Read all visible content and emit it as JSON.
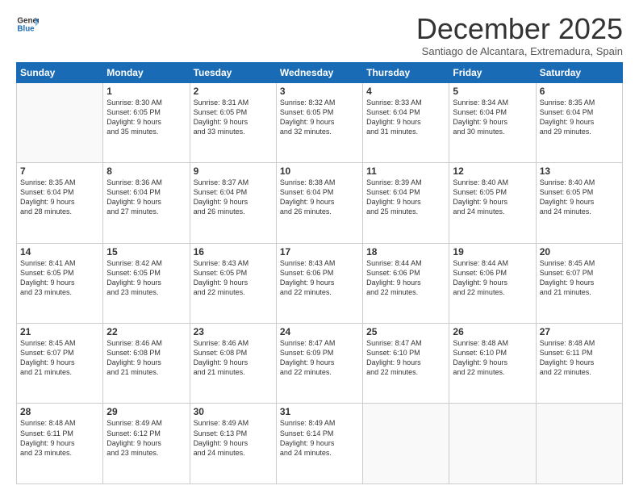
{
  "header": {
    "logo_general": "General",
    "logo_blue": "Blue",
    "month_title": "December 2025",
    "location": "Santiago de Alcantara, Extremadura, Spain"
  },
  "days_of_week": [
    "Sunday",
    "Monday",
    "Tuesday",
    "Wednesday",
    "Thursday",
    "Friday",
    "Saturday"
  ],
  "weeks": [
    [
      {
        "day": "",
        "info": ""
      },
      {
        "day": "1",
        "info": "Sunrise: 8:30 AM\nSunset: 6:05 PM\nDaylight: 9 hours\nand 35 minutes."
      },
      {
        "day": "2",
        "info": "Sunrise: 8:31 AM\nSunset: 6:05 PM\nDaylight: 9 hours\nand 33 minutes."
      },
      {
        "day": "3",
        "info": "Sunrise: 8:32 AM\nSunset: 6:05 PM\nDaylight: 9 hours\nand 32 minutes."
      },
      {
        "day": "4",
        "info": "Sunrise: 8:33 AM\nSunset: 6:04 PM\nDaylight: 9 hours\nand 31 minutes."
      },
      {
        "day": "5",
        "info": "Sunrise: 8:34 AM\nSunset: 6:04 PM\nDaylight: 9 hours\nand 30 minutes."
      },
      {
        "day": "6",
        "info": "Sunrise: 8:35 AM\nSunset: 6:04 PM\nDaylight: 9 hours\nand 29 minutes."
      }
    ],
    [
      {
        "day": "7",
        "info": "Sunrise: 8:35 AM\nSunset: 6:04 PM\nDaylight: 9 hours\nand 28 minutes."
      },
      {
        "day": "8",
        "info": "Sunrise: 8:36 AM\nSunset: 6:04 PM\nDaylight: 9 hours\nand 27 minutes."
      },
      {
        "day": "9",
        "info": "Sunrise: 8:37 AM\nSunset: 6:04 PM\nDaylight: 9 hours\nand 26 minutes."
      },
      {
        "day": "10",
        "info": "Sunrise: 8:38 AM\nSunset: 6:04 PM\nDaylight: 9 hours\nand 26 minutes."
      },
      {
        "day": "11",
        "info": "Sunrise: 8:39 AM\nSunset: 6:04 PM\nDaylight: 9 hours\nand 25 minutes."
      },
      {
        "day": "12",
        "info": "Sunrise: 8:40 AM\nSunset: 6:05 PM\nDaylight: 9 hours\nand 24 minutes."
      },
      {
        "day": "13",
        "info": "Sunrise: 8:40 AM\nSunset: 6:05 PM\nDaylight: 9 hours\nand 24 minutes."
      }
    ],
    [
      {
        "day": "14",
        "info": "Sunrise: 8:41 AM\nSunset: 6:05 PM\nDaylight: 9 hours\nand 23 minutes."
      },
      {
        "day": "15",
        "info": "Sunrise: 8:42 AM\nSunset: 6:05 PM\nDaylight: 9 hours\nand 23 minutes."
      },
      {
        "day": "16",
        "info": "Sunrise: 8:43 AM\nSunset: 6:05 PM\nDaylight: 9 hours\nand 22 minutes."
      },
      {
        "day": "17",
        "info": "Sunrise: 8:43 AM\nSunset: 6:06 PM\nDaylight: 9 hours\nand 22 minutes."
      },
      {
        "day": "18",
        "info": "Sunrise: 8:44 AM\nSunset: 6:06 PM\nDaylight: 9 hours\nand 22 minutes."
      },
      {
        "day": "19",
        "info": "Sunrise: 8:44 AM\nSunset: 6:06 PM\nDaylight: 9 hours\nand 22 minutes."
      },
      {
        "day": "20",
        "info": "Sunrise: 8:45 AM\nSunset: 6:07 PM\nDaylight: 9 hours\nand 21 minutes."
      }
    ],
    [
      {
        "day": "21",
        "info": "Sunrise: 8:45 AM\nSunset: 6:07 PM\nDaylight: 9 hours\nand 21 minutes."
      },
      {
        "day": "22",
        "info": "Sunrise: 8:46 AM\nSunset: 6:08 PM\nDaylight: 9 hours\nand 21 minutes."
      },
      {
        "day": "23",
        "info": "Sunrise: 8:46 AM\nSunset: 6:08 PM\nDaylight: 9 hours\nand 21 minutes."
      },
      {
        "day": "24",
        "info": "Sunrise: 8:47 AM\nSunset: 6:09 PM\nDaylight: 9 hours\nand 22 minutes."
      },
      {
        "day": "25",
        "info": "Sunrise: 8:47 AM\nSunset: 6:10 PM\nDaylight: 9 hours\nand 22 minutes."
      },
      {
        "day": "26",
        "info": "Sunrise: 8:48 AM\nSunset: 6:10 PM\nDaylight: 9 hours\nand 22 minutes."
      },
      {
        "day": "27",
        "info": "Sunrise: 8:48 AM\nSunset: 6:11 PM\nDaylight: 9 hours\nand 22 minutes."
      }
    ],
    [
      {
        "day": "28",
        "info": "Sunrise: 8:48 AM\nSunset: 6:11 PM\nDaylight: 9 hours\nand 23 minutes."
      },
      {
        "day": "29",
        "info": "Sunrise: 8:49 AM\nSunset: 6:12 PM\nDaylight: 9 hours\nand 23 minutes."
      },
      {
        "day": "30",
        "info": "Sunrise: 8:49 AM\nSunset: 6:13 PM\nDaylight: 9 hours\nand 24 minutes."
      },
      {
        "day": "31",
        "info": "Sunrise: 8:49 AM\nSunset: 6:14 PM\nDaylight: 9 hours\nand 24 minutes."
      },
      {
        "day": "",
        "info": ""
      },
      {
        "day": "",
        "info": ""
      },
      {
        "day": "",
        "info": ""
      }
    ]
  ]
}
